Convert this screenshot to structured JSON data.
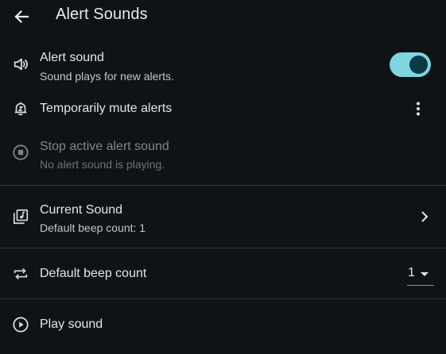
{
  "header": {
    "back_icon": "arrow-left-icon",
    "title": "Alert Sounds"
  },
  "alert_sound": {
    "icon": "volume-icon",
    "label": "Alert sound",
    "description": "Sound plays for new alerts.",
    "enabled": true,
    "accent_color": "#7dd6e0"
  },
  "mute": {
    "icon": "bell-timer-icon",
    "label": "Temporarily mute alerts",
    "menu_icon": "more-vert-icon"
  },
  "stop": {
    "icon": "stop-circle-icon",
    "label": "Stop active alert sound",
    "description": "No alert sound is playing.",
    "disabled": true
  },
  "current_sound": {
    "icon": "music-library-icon",
    "label": "Current Sound",
    "description": "Default beep count: 1",
    "chevron_icon": "chevron-right-icon"
  },
  "beep_count": {
    "icon": "repeat-icon",
    "label": "Default beep count",
    "selected_value": "1"
  },
  "play": {
    "icon": "play-circle-icon",
    "label": "Play sound"
  }
}
